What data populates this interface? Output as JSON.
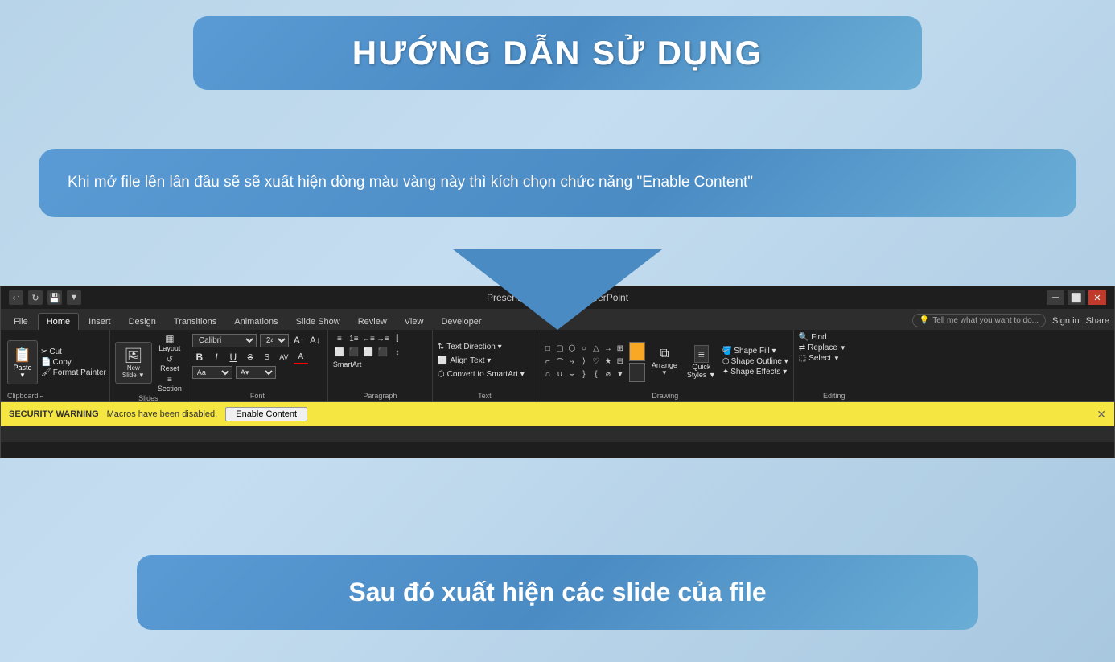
{
  "page": {
    "background": "#b8d4e8"
  },
  "title_box": {
    "text": "HƯỚNG DẪN SỬ DỤNG"
  },
  "instruction_bubble": {
    "text": "Khi mở file lên lần đầu sẽ sẽ xuất hiện  dòng màu vàng này thì kích chọn chức năng \"Enable Content\""
  },
  "powerpoint": {
    "titlebar": {
      "title": "Presentation1.pptm - PowerPoint",
      "undo_icon": "↩",
      "redo_icon": "↻",
      "customize_icon": "▼"
    },
    "tabs": [
      "Home",
      "Insert",
      "Design",
      "Transitions",
      "Review",
      "View",
      "Developer"
    ],
    "active_tab": "Home",
    "tell_me": "Tell me what you want to do...",
    "sign_in": "Sign in",
    "share": "Share",
    "ribbon": {
      "clipboard": {
        "label": "Clipboard",
        "paste": "Paste",
        "cut": "Cut",
        "copy": "Copy",
        "format_painter": "Format Painter"
      },
      "slides": {
        "label": "Slides",
        "new_slide": "New\nSlide",
        "layout": "Layout",
        "reset": "Reset",
        "section": "Section"
      },
      "font": {
        "label": "Font",
        "font_name": "Calibri",
        "font_size": "24",
        "bold": "B",
        "italic": "I",
        "underline": "U"
      },
      "paragraph": {
        "label": "Paragraph"
      },
      "text": {
        "label": "Text",
        "text_direction": "Text Direction ▾",
        "align_text": "Align Text ▾",
        "convert_smartart": "Convert to SmartArt ▾"
      },
      "drawing": {
        "label": "Drawing",
        "arrange": "Arrange",
        "quick_styles": "Quick\nStyles",
        "shape_fill": "Shape Fill ▾",
        "shape_outline": "Shape Outline ▾",
        "shape_effects": "Shape Effects ▾"
      },
      "editing": {
        "label": "Editing",
        "find": "Find",
        "replace": "Replace",
        "select": "Select"
      }
    },
    "security_bar": {
      "warning": "SECURITY WARNING",
      "message": "Macros have been disabled.",
      "enable_btn": "Enable Content",
      "close": "✕"
    }
  },
  "bottom_box": {
    "text": "Sau đó xuất hiện các slide của file"
  }
}
